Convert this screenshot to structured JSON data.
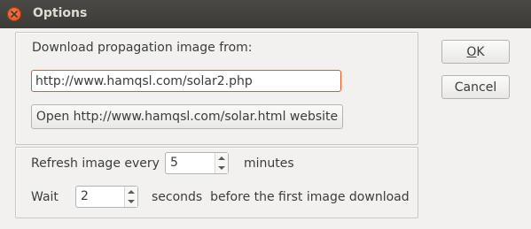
{
  "window": {
    "title": "Options"
  },
  "source": {
    "heading": "Download propagation image from:",
    "url_value": "http://www.hamqsl.com/solar2.php",
    "open_button_label": "Open http://www.hamqsl.com/solar.html website"
  },
  "refresh": {
    "label_prefix": "Refresh image every",
    "value": "5",
    "label_suffix": "minutes"
  },
  "wait": {
    "label_prefix": "Wait",
    "value": "2",
    "label_suffix": "seconds  before the first image download"
  },
  "buttons": {
    "ok_mnemonic": "O",
    "ok_rest": "K",
    "cancel": "Cancel"
  },
  "colors": {
    "titlebar": "#3c3b37",
    "close_button": "#e0531e",
    "focus_border": "#e05a25",
    "window_bg": "#f2f1f0"
  },
  "icons": {
    "close": "close-icon",
    "spin_up": "chevron-up-icon",
    "spin_down": "chevron-down-icon"
  }
}
